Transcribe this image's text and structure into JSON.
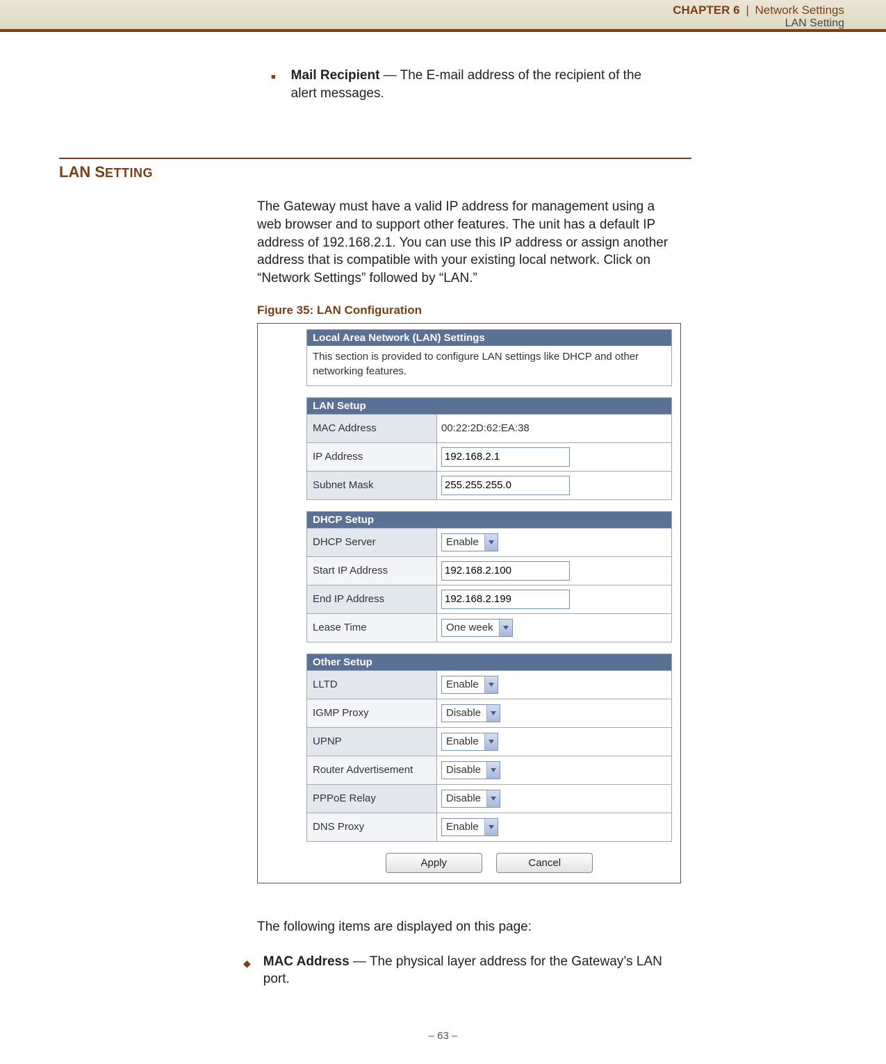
{
  "header": {
    "chapter_label": "CHAPTER 6",
    "separator": "|",
    "title": "Network Settings",
    "subtitle": "LAN Setting"
  },
  "intro_bullet": {
    "term": "Mail Recipient",
    "desc": " — The E-mail address of the recipient of the alert messages."
  },
  "section": {
    "heading_big": "LAN S",
    "heading_small": "ETTING",
    "paragraph": "The Gateway must have a valid IP address for management using a web browser and to support other features. The unit has a default IP address of 192.168.2.1. You can use this IP address or assign another address that is compatible with your existing local network. Click on “Network Settings” followed by “LAN.”",
    "figure_caption": "Figure 35:  LAN Configuration"
  },
  "figure": {
    "panel_title": "Local Area Network (LAN) Settings",
    "panel_desc": "This section is provided to configure LAN settings like DHCP and other networking features.",
    "lan_setup": {
      "title": "LAN Setup",
      "mac_label": "MAC Address",
      "mac_value": "00:22:2D:62:EA:38",
      "ip_label": "IP Address",
      "ip_value": "192.168.2.1",
      "sm_label": "Subnet Mask",
      "sm_value": "255.255.255.0"
    },
    "dhcp_setup": {
      "title": "DHCP Setup",
      "server_label": "DHCP Server",
      "server_value": "Enable",
      "start_label": "Start IP Address",
      "start_value": "192.168.2.100",
      "end_label": "End IP Address",
      "end_value": "192.168.2.199",
      "lease_label": "Lease Time",
      "lease_value": "One week"
    },
    "other_setup": {
      "title": "Other Setup",
      "lltd_label": "LLTD",
      "lltd_value": "Enable",
      "igmp_label": "IGMP Proxy",
      "igmp_value": "Disable",
      "upnp_label": "UPNP",
      "upnp_value": "Enable",
      "ra_label": "Router Advertisement",
      "ra_value": "Disable",
      "pppoe_label": "PPPoE Relay",
      "pppoe_value": "Disable",
      "dns_label": "DNS Proxy",
      "dns_value": "Enable"
    },
    "buttons": {
      "apply": "Apply",
      "cancel": "Cancel"
    }
  },
  "after": {
    "lead": "The following items are displayed on this page:",
    "mac_term": "MAC Address",
    "mac_desc": " — The physical layer address for the Gateway’s LAN port."
  },
  "footer": {
    "page": "–  63  –"
  }
}
